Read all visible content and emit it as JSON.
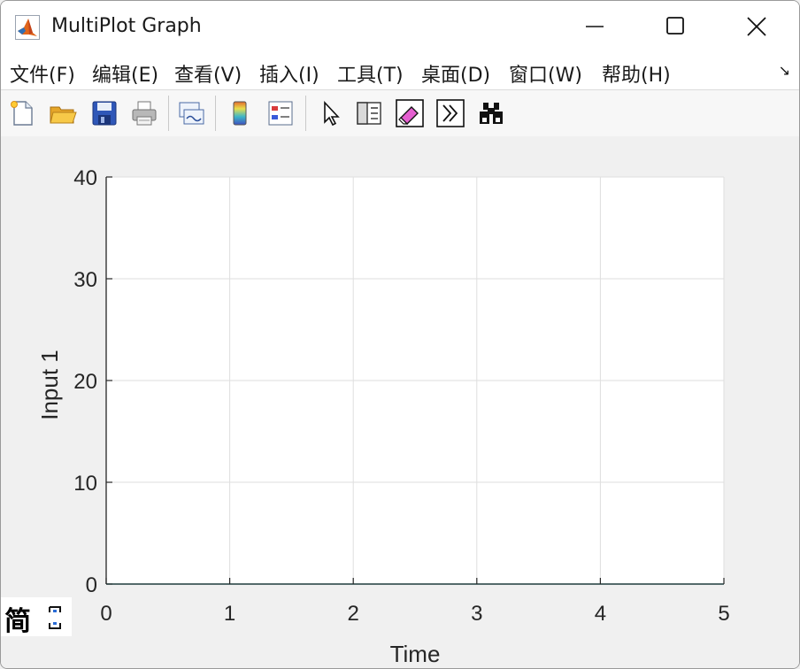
{
  "window": {
    "title": "MultiPlot Graph"
  },
  "menu": {
    "items": [
      {
        "label": "文件(F)"
      },
      {
        "label": "编辑(E)"
      },
      {
        "label": "查看(V)"
      },
      {
        "label": "插入(I)"
      },
      {
        "label": "工具(T)"
      },
      {
        "label": "桌面(D)"
      },
      {
        "label": "窗口(W)"
      },
      {
        "label": "帮助(H)"
      }
    ]
  },
  "toolbar": {
    "buttons": [
      {
        "icon": "new-figure-icon"
      },
      {
        "icon": "open-file-icon"
      },
      {
        "icon": "save-icon"
      },
      {
        "icon": "print-icon"
      },
      {
        "icon": "link-plot-icon"
      },
      {
        "icon": "colorbar-icon"
      },
      {
        "icon": "legend-icon"
      },
      {
        "icon": "select-arrow-icon"
      },
      {
        "icon": "property-inspector-icon"
      },
      {
        "icon": "brush-eraser-icon"
      },
      {
        "icon": "forward-icon"
      },
      {
        "icon": "binoculars-icon"
      }
    ]
  },
  "chart_data": {
    "type": "line",
    "title": "",
    "xlabel": "Time",
    "ylabel": "Input 1",
    "xlim": [
      0,
      5
    ],
    "ylim": [
      0,
      40
    ],
    "xticks": [
      "0",
      "1",
      "2",
      "3",
      "4",
      "5"
    ],
    "yticks": [
      "0",
      "10",
      "20",
      "30",
      "40"
    ],
    "grid": true,
    "series": [
      {
        "x": [
          0,
          5
        ],
        "values": [
          0,
          0
        ],
        "color": "#4fc3c8"
      }
    ]
  },
  "ime": {
    "mode_char": "简"
  }
}
